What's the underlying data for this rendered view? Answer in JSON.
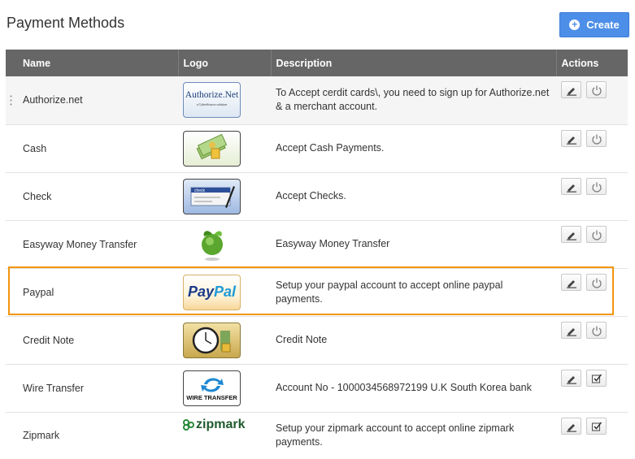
{
  "page": {
    "title": "Payment Methods",
    "create_label": "Create"
  },
  "columns": {
    "name": "Name",
    "logo": "Logo",
    "description": "Description",
    "actions": "Actions"
  },
  "rows": [
    {
      "name": "Authorize.net",
      "description": "To Accept cerdit cards\\, you need to sign up for Authorize.net & a merchant account.",
      "logo": {
        "icon": "authorize-net-logo",
        "text": "Authorize.Net",
        "subtext": "a CyberSource solution"
      },
      "second_action": "power-icon"
    },
    {
      "name": "Cash",
      "description": "Accept Cash Payments.",
      "logo": {
        "icon": "cash-logo"
      },
      "second_action": "power-icon"
    },
    {
      "name": "Check",
      "description": "Accept Checks.",
      "logo": {
        "icon": "check-logo",
        "text": "check"
      },
      "second_action": "power-icon"
    },
    {
      "name": "Easyway Money Transfer",
      "description": "Easyway Money Transfer",
      "logo": {
        "icon": "globe-leaf-logo"
      },
      "second_action": "power-icon"
    },
    {
      "name": "Paypal",
      "description": "Setup your paypal account to accept online paypal payments.",
      "logo": {
        "icon": "paypal-logo",
        "text": "PayPal"
      },
      "second_action": "power-icon"
    },
    {
      "name": "Credit Note",
      "description": "Credit Note",
      "logo": {
        "icon": "clock-coins-logo"
      },
      "second_action": "power-icon"
    },
    {
      "name": "Wire Transfer",
      "description": "Account No - 1000034568972199 U.K South Korea bank",
      "logo": {
        "icon": "wire-transfer-logo",
        "text": "WIRE TRANSFER"
      },
      "second_action": "activate-icon"
    },
    {
      "name": "Zipmark",
      "description": "Setup your zipmark account to accept online zipmark payments.",
      "logo": {
        "icon": "zipmark-logo",
        "text": "zipmark"
      },
      "second_action": "activate-icon"
    }
  ],
  "colors": {
    "header_bg": "#666666",
    "create_button": "#4d8fe8",
    "highlight": "#f0960e"
  }
}
